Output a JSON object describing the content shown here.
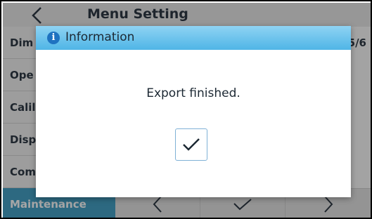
{
  "header": {
    "title": "Menu Setting"
  },
  "sidebar": {
    "items": [
      {
        "label": "Dim"
      },
      {
        "label": "Ope"
      },
      {
        "label": "Calil"
      },
      {
        "label": "Disp"
      },
      {
        "label": "Com"
      },
      {
        "label": "Maintenance"
      }
    ]
  },
  "content": {
    "page_indicator": "5/6"
  },
  "dialog": {
    "title": "Information",
    "message": "Export finished."
  },
  "colors": {
    "active": "#45a1c6",
    "titlebar": "#4fb5e6",
    "info_icon": "#1e72c0"
  }
}
